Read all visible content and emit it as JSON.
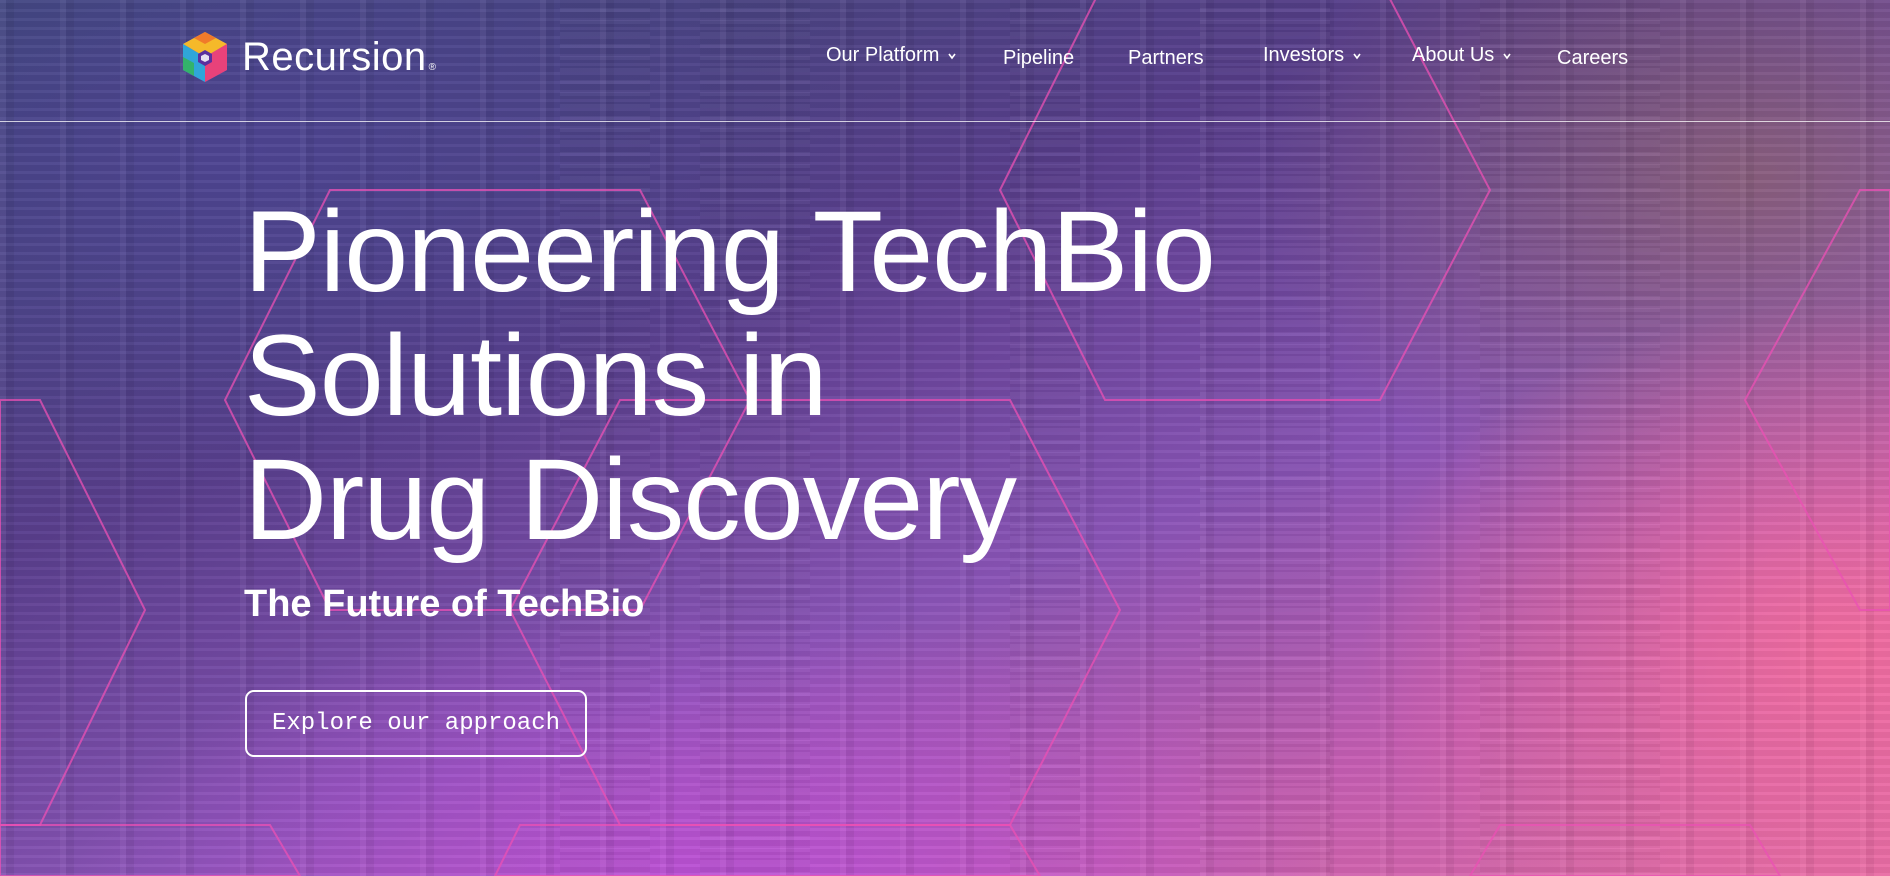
{
  "brand": {
    "name": "Recursion",
    "reg_mark": "®",
    "logo_icon": "hexagon-cube-logo-icon"
  },
  "nav": {
    "items": [
      {
        "label": "Our Platform",
        "has_dropdown": true,
        "icon": "chevron-down-icon"
      },
      {
        "label": "Pipeline",
        "has_dropdown": false
      },
      {
        "label": "Partners",
        "has_dropdown": false
      },
      {
        "label": "Investors",
        "has_dropdown": true,
        "icon": "chevron-down-icon"
      },
      {
        "label": "About Us",
        "has_dropdown": true,
        "icon": "chevron-down-icon"
      },
      {
        "label": "Careers",
        "has_dropdown": false
      }
    ]
  },
  "hero": {
    "headline_lines": [
      "Pioneering TechBio",
      "Solutions in",
      "Drug Discovery"
    ],
    "subheading": "The Future of TechBio",
    "cta_label": "Explore our approach"
  },
  "colors": {
    "text": "#ffffff",
    "hex_line": "#e04fb0",
    "gradient_start": "#3d4a78",
    "gradient_mid": "#8b55b8",
    "gradient_end": "#e56ea8"
  }
}
